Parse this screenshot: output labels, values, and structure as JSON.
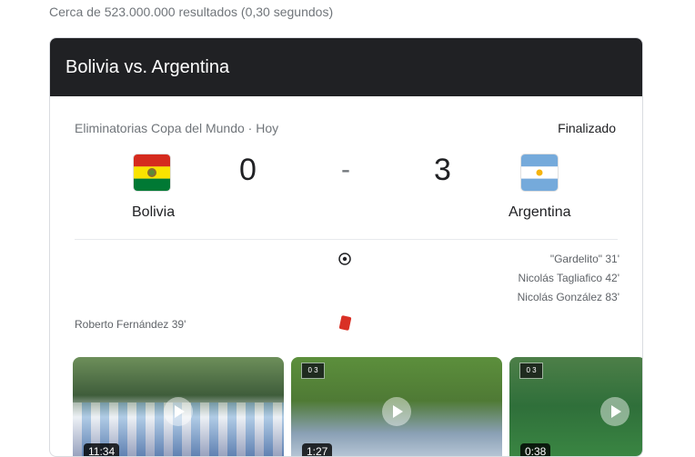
{
  "results_count": "Cerca de 523.000.000 resultados (0,30 segundos)",
  "match": {
    "title": "Bolivia vs. Argentina",
    "competition": "Eliminatorias Copa del Mundo · Hoy",
    "status": "Finalizado",
    "home": {
      "name": "Bolivia",
      "score": "0",
      "flag_colors": [
        "#d52b1e",
        "#f9e300",
        "#007934"
      ]
    },
    "away": {
      "name": "Argentina",
      "score": "3",
      "flag_colors": [
        "#75aadb",
        "#ffffff",
        "#75aadb"
      ]
    },
    "separator": "-",
    "away_goals": [
      "\"Gardelito\" 31'",
      "Nicolás Tagliafico 42'",
      "Nicolás González 83'"
    ],
    "home_red_cards": [
      "Roberto Fernández 39'"
    ]
  },
  "videos": [
    {
      "duration": "11:34"
    },
    {
      "duration": "1:27",
      "scorebug": "0 3"
    },
    {
      "duration": "0:38",
      "scorebug": "0 3"
    }
  ]
}
